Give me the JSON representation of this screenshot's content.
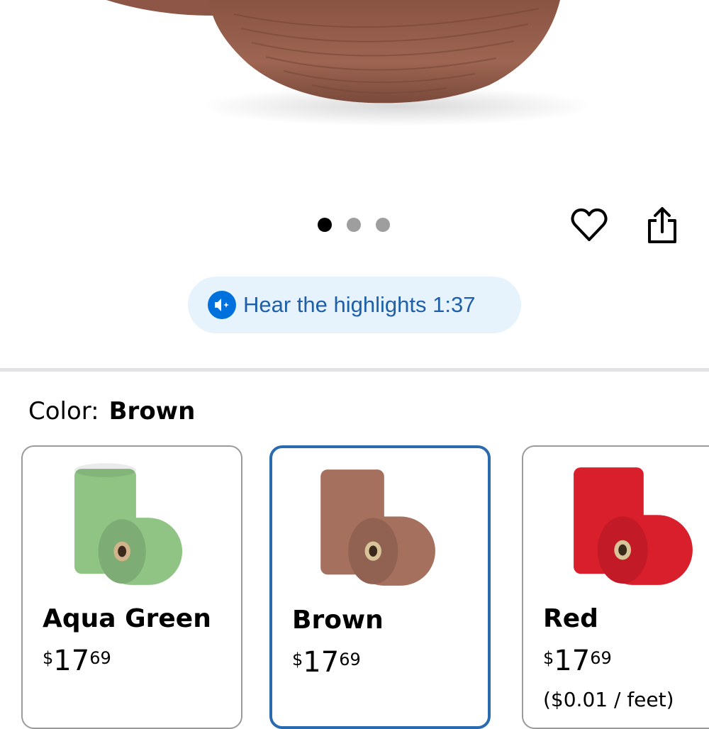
{
  "gallery": {
    "image_count": 3,
    "active_index": 0,
    "favorite_icon": "heart-outline-icon",
    "share_icon": "share-icon"
  },
  "audio": {
    "label": "Hear the highlights 1:37",
    "icon": "audio-sparkle-icon",
    "accent": "#0071dc"
  },
  "variant": {
    "label": "Color:",
    "selected": "Brown",
    "options": [
      {
        "name": "Aqua Green",
        "currency": "$",
        "whole": "17",
        "cents": "69",
        "unit": "",
        "swatch": "#8fc485"
      },
      {
        "name": "Brown",
        "currency": "$",
        "whole": "17",
        "cents": "69",
        "unit": "",
        "swatch": "#a5705e"
      },
      {
        "name": "Red",
        "currency": "$",
        "whole": "17",
        "cents": "69",
        "unit": "($0.01 / feet)",
        "swatch": "#d91f2c"
      }
    ]
  },
  "colors": {
    "selected_border": "#2a6bb0",
    "audio_bg": "#e6f3fc",
    "audio_text": "#1f5fa8"
  }
}
